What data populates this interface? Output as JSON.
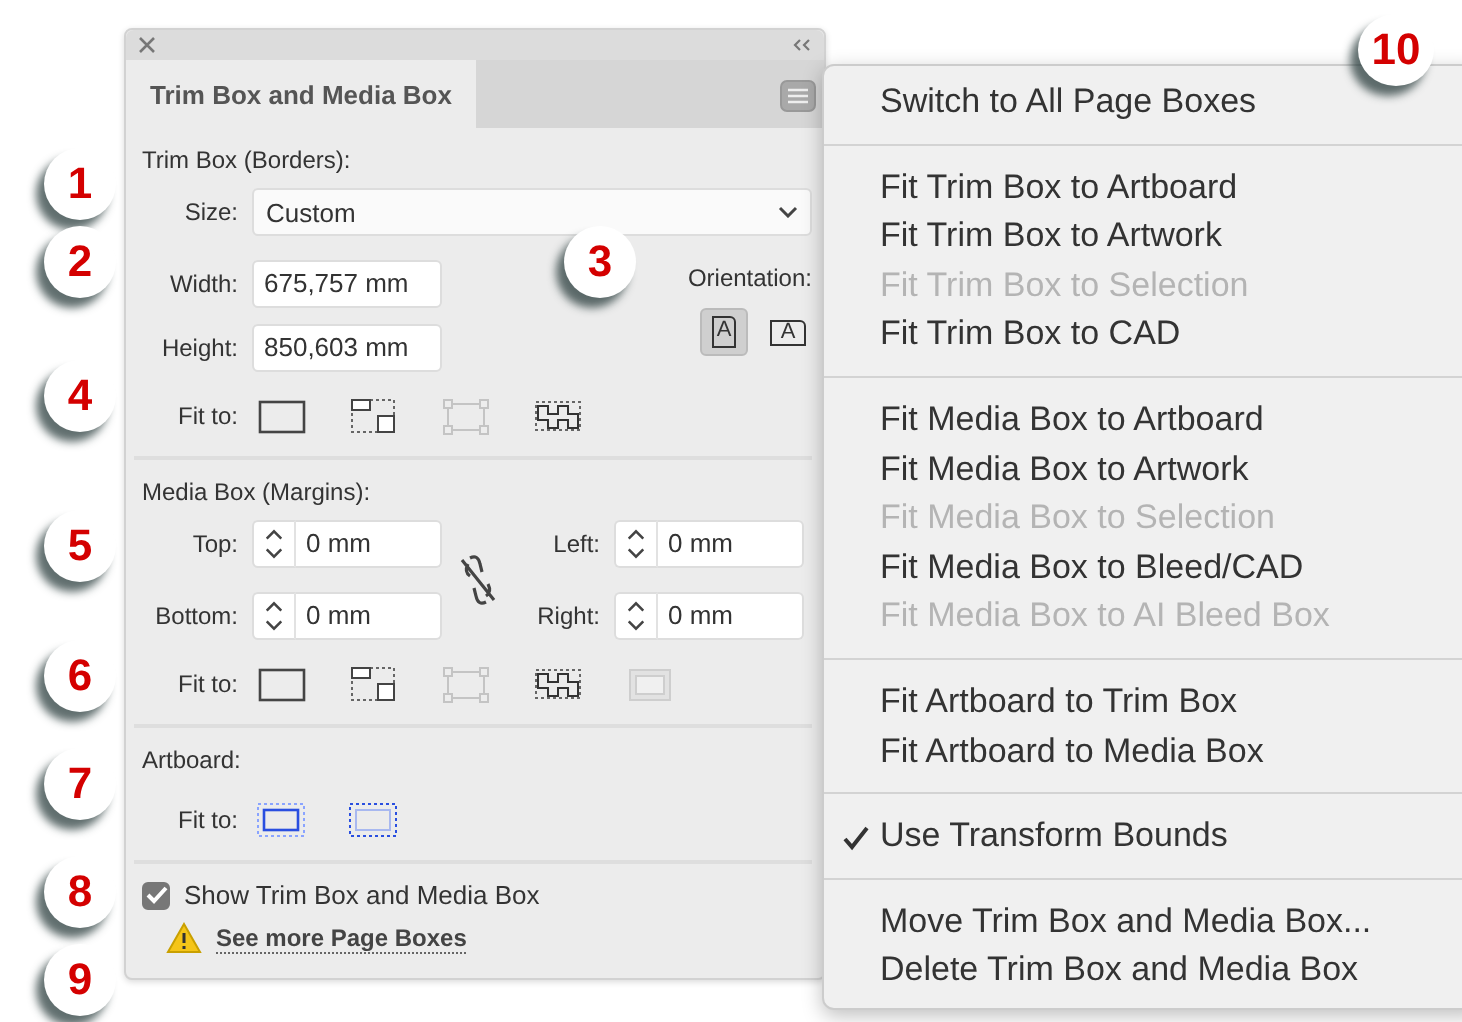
{
  "panel": {
    "tab": "Trim Box and Media Box",
    "trim_box": {
      "heading": "Trim Box (Borders):",
      "size_label": "Size:",
      "size_value": "Custom",
      "width_label": "Width:",
      "width_value": "675,757 mm",
      "height_label": "Height:",
      "height_value": "850,603 mm",
      "orientation_label": "Orientation:",
      "orientations": [
        {
          "glyph": "A",
          "selected": true
        },
        {
          "glyph": "A",
          "selected": false
        }
      ],
      "fit_label": "Fit to:",
      "fit_buttons": [
        {
          "kind": "artboard",
          "disabled": false
        },
        {
          "kind": "artwork",
          "disabled": false
        },
        {
          "kind": "selection",
          "disabled": true
        },
        {
          "kind": "cad",
          "disabled": false
        }
      ]
    },
    "media_box": {
      "heading": "Media Box (Margins):",
      "top_label": "Top:",
      "top_value": "0 mm",
      "left_label": "Left:",
      "left_value": "0 mm",
      "bottom_label": "Bottom:",
      "bottom_value": "0 mm",
      "right_label": "Right:",
      "right_value": "0 mm",
      "fit_label": "Fit to:",
      "fit_buttons": [
        {
          "kind": "artboard",
          "disabled": false
        },
        {
          "kind": "artwork",
          "disabled": false
        },
        {
          "kind": "selection",
          "disabled": true
        },
        {
          "kind": "cad",
          "disabled": false
        },
        {
          "kind": "bleed",
          "disabled": true
        }
      ]
    },
    "artboard": {
      "heading": "Artboard:",
      "fit_label": "Fit to:",
      "fit_buttons": [
        {
          "kind": "trim"
        },
        {
          "kind": "media"
        }
      ]
    },
    "show_boxes": {
      "label": "Show Trim Box and Media Box",
      "checked": true
    },
    "more_link": "See more Page Boxes"
  },
  "menu": {
    "groups": [
      [
        {
          "label": "Switch to All Page Boxes",
          "disabled": false,
          "checked": false
        }
      ],
      [
        {
          "label": "Fit Trim Box to Artboard",
          "disabled": false,
          "checked": false
        },
        {
          "label": "Fit Trim Box to Artwork",
          "disabled": false,
          "checked": false
        },
        {
          "label": "Fit Trim Box to Selection",
          "disabled": true,
          "checked": false
        },
        {
          "label": "Fit Trim Box to CAD",
          "disabled": false,
          "checked": false
        }
      ],
      [
        {
          "label": "Fit Media Box to Artboard",
          "disabled": false,
          "checked": false
        },
        {
          "label": "Fit Media Box to Artwork",
          "disabled": false,
          "checked": false
        },
        {
          "label": "Fit Media Box to Selection",
          "disabled": true,
          "checked": false
        },
        {
          "label": "Fit Media Box to Bleed/CAD",
          "disabled": false,
          "checked": false
        },
        {
          "label": "Fit Media Box to AI Bleed Box",
          "disabled": true,
          "checked": false
        }
      ],
      [
        {
          "label": "Fit Artboard to Trim Box",
          "disabled": false,
          "checked": false
        },
        {
          "label": "Fit Artboard to Media Box",
          "disabled": false,
          "checked": false
        }
      ],
      [
        {
          "label": "Use Transform Bounds",
          "disabled": false,
          "checked": true
        }
      ],
      [
        {
          "label": "Move Trim Box and Media Box...",
          "disabled": false,
          "checked": false
        },
        {
          "label": "Delete Trim Box and Media Box",
          "disabled": false,
          "checked": false
        }
      ]
    ]
  },
  "callouts": [
    {
      "number": "1"
    },
    {
      "number": "2"
    },
    {
      "number": "3"
    },
    {
      "number": "4"
    },
    {
      "number": "5"
    },
    {
      "number": "6"
    },
    {
      "number": "7"
    },
    {
      "number": "8"
    },
    {
      "number": "9"
    },
    {
      "number": "10"
    }
  ]
}
